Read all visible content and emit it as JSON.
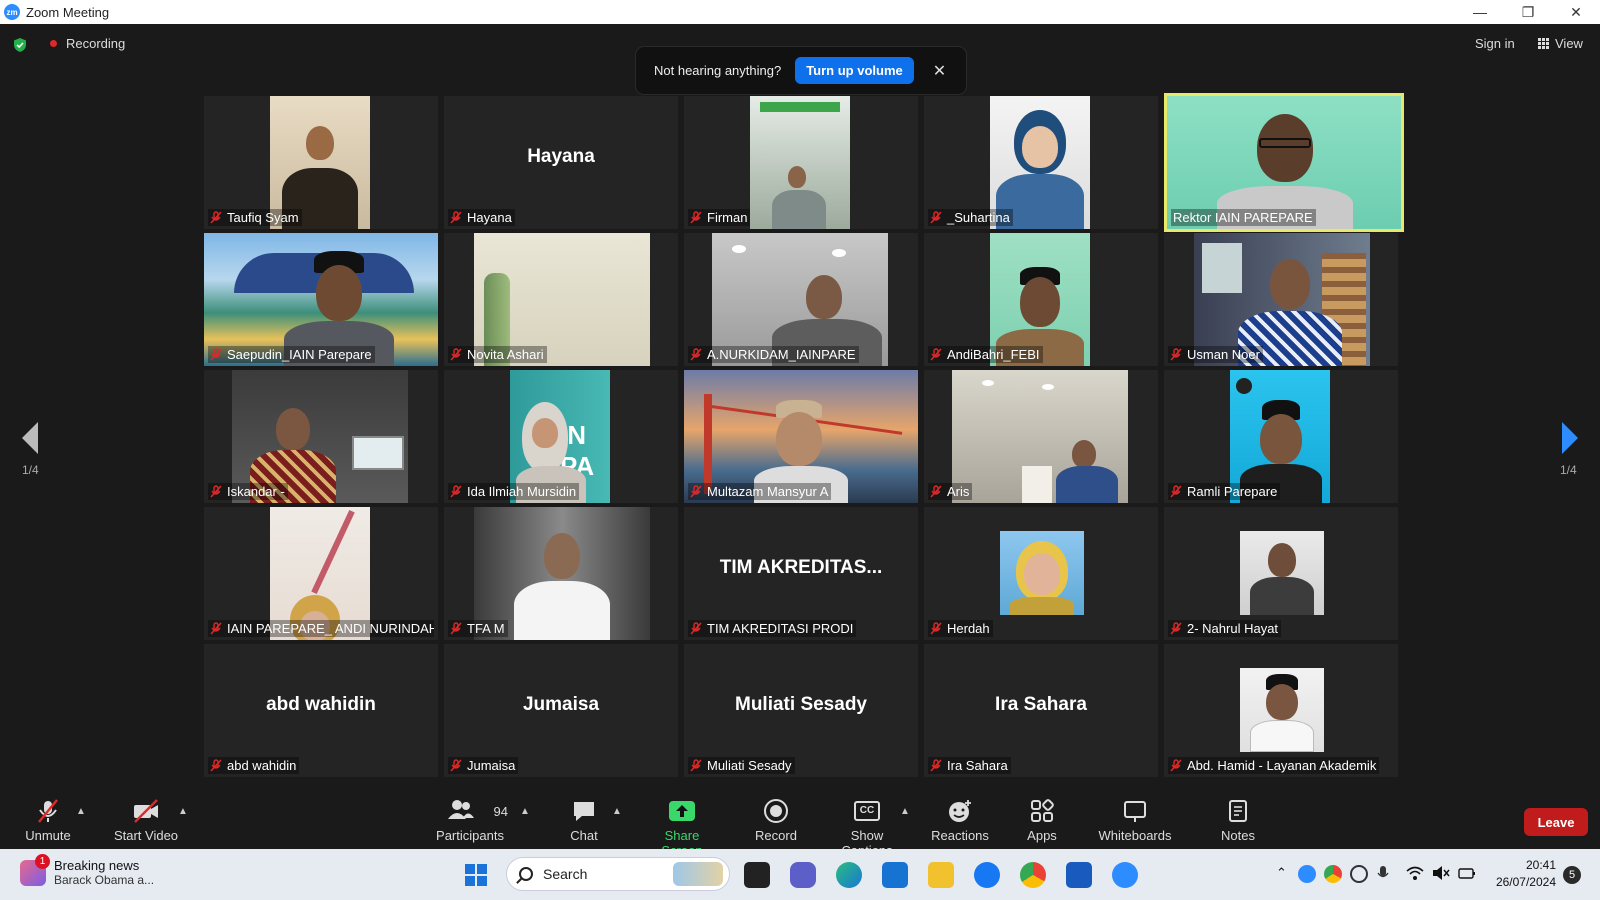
{
  "window": {
    "title": "Zoom Meeting",
    "logo": "zm"
  },
  "topbar": {
    "recording_label": "Recording",
    "sign_in": "Sign in",
    "view": "View"
  },
  "banner": {
    "text": "Not hearing anything?",
    "button": "Turn up volume"
  },
  "pagination": {
    "left": "1/4",
    "right": "1/4"
  },
  "participants": [
    {
      "name": "Taufiq Syam",
      "video": true
    },
    {
      "name": "Hayana",
      "video": false,
      "display": "Hayana"
    },
    {
      "name": "Firman",
      "video": true
    },
    {
      "name": "_Suhartina",
      "video": true
    },
    {
      "name": "Rektor IAIN PAREPARE",
      "video": true,
      "active": true
    },
    {
      "name": "Saepudin_IAIN Parepare",
      "video": true
    },
    {
      "name": "Novita Ashari",
      "video": true
    },
    {
      "name": "A.NURKIDAM_IAINPARE",
      "video": true
    },
    {
      "name": "AndiBahri_FEBI",
      "video": true
    },
    {
      "name": "Usman Noer",
      "video": true
    },
    {
      "name": "Iskandar -",
      "video": true
    },
    {
      "name": "Ida Ilmiah Mursidin",
      "video": true
    },
    {
      "name": "Multazam Mansyur A",
      "video": true
    },
    {
      "name": "Aris",
      "video": true
    },
    {
      "name": "Ramli Parepare",
      "video": true
    },
    {
      "name": "IAIN PAREPARE_ ANDI NURINDAH...",
      "video": true
    },
    {
      "name": "TFA M",
      "video": true
    },
    {
      "name": "TIM AKREDITASI PRODI",
      "video": false,
      "display": "TIM  AKREDITAS..."
    },
    {
      "name": "Herdah",
      "video": true
    },
    {
      "name": "2- Nahrul Hayat",
      "video": true
    },
    {
      "name": "abd wahidin",
      "video": false,
      "display": "abd wahidin"
    },
    {
      "name": "Jumaisa",
      "video": false,
      "display": "Jumaisa"
    },
    {
      "name": "Muliati Sesady",
      "video": false,
      "display": "Muliati Sesady"
    },
    {
      "name": "Ira Sahara",
      "video": false,
      "display": "Ira Sahara"
    },
    {
      "name": "Abd. Hamid - Layanan Akademik",
      "video": true
    }
  ],
  "toolbar": {
    "unmute": "Unmute",
    "start_video": "Start Video",
    "participants": "Participants",
    "participants_count": "94",
    "chat": "Chat",
    "share_screen": "Share Screen",
    "record": "Record",
    "show_captions": "Show Captions",
    "captions_icon_text": "CC",
    "reactions": "Reactions",
    "apps": "Apps",
    "whiteboards": "Whiteboards",
    "notes": "Notes",
    "leave": "Leave"
  },
  "taskbar": {
    "news_title": "Breaking news",
    "news_sub": "Barack Obama a...",
    "news_badge": "1",
    "search": "Search",
    "time": "20:41",
    "date": "26/07/2024",
    "notif_count": "5"
  },
  "colors": {
    "active_border": "#e8e86a",
    "accent_blue": "#0e71eb",
    "leave_red": "#c11c1c",
    "share_green": "#3ad86b"
  }
}
